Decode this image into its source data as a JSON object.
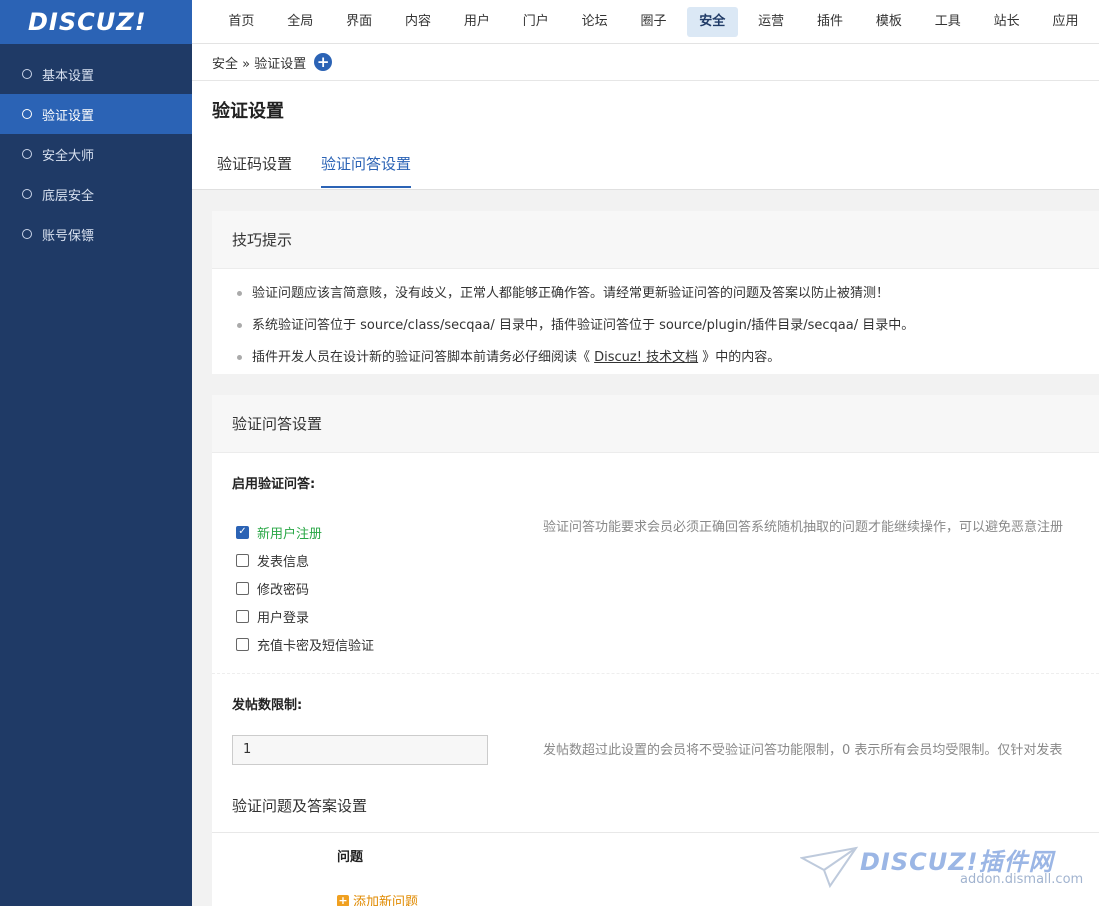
{
  "logo": "DISCUZ!",
  "nav": [
    "首页",
    "全局",
    "界面",
    "内容",
    "用户",
    "门户",
    "论坛",
    "圈子",
    "安全",
    "运营",
    "插件",
    "模板",
    "工具",
    "站长",
    "应用"
  ],
  "sidebar": [
    {
      "label": "基本设置",
      "active": false
    },
    {
      "label": "验证设置",
      "active": true
    },
    {
      "label": "安全大师",
      "active": false
    },
    {
      "label": "底层安全",
      "active": false
    },
    {
      "label": "账号保镖",
      "active": false
    }
  ],
  "breadcrumb": "安全 » 验证设置",
  "page_title": "验证设置",
  "tabs": [
    "验证码设置",
    "验证问答设置"
  ],
  "tips": {
    "title": "技巧提示",
    "items": [
      "验证问题应该言简意赅，没有歧义，正常人都能够正确作答。请经常更新验证问答的问题及答案以防止被猜测！",
      "系统验证问答位于 source/class/secqaa/ 目录中，插件验证问答位于 source/plugin/插件目录/secqaa/ 目录中。"
    ],
    "item3_pre": "插件开发人员在设计新的验证问答脚本前请务必仔细阅读《 ",
    "item3_link": "Discuz! 技术文档",
    "item3_post": " 》中的内容。"
  },
  "qa_settings": {
    "title": "验证问答设置",
    "enable_label": "启用验证问答:",
    "enable_desc": "验证问答功能要求会员必须正确回答系统随机抽取的问题才能继续操作，可以避免恶意注册",
    "options": [
      {
        "label": "新用户注册",
        "checked": true
      },
      {
        "label": "发表信息",
        "checked": false
      },
      {
        "label": "修改密码",
        "checked": false
      },
      {
        "label": "用户登录",
        "checked": false
      },
      {
        "label": "充值卡密及短信验证",
        "checked": false
      }
    ],
    "post_limit_label": "发帖数限制:",
    "post_limit_value": "1",
    "post_limit_desc": "发帖数超过此设置的会员将不受验证问答功能限制，0 表示所有会员均受限制。仅针对发表",
    "qa_title": "验证问题及答案设置",
    "question_col": "问题",
    "add_question": "添加新问题"
  },
  "watermark": {
    "brand": "DISCUZ!插件网",
    "site": "addon.dismall.com"
  }
}
